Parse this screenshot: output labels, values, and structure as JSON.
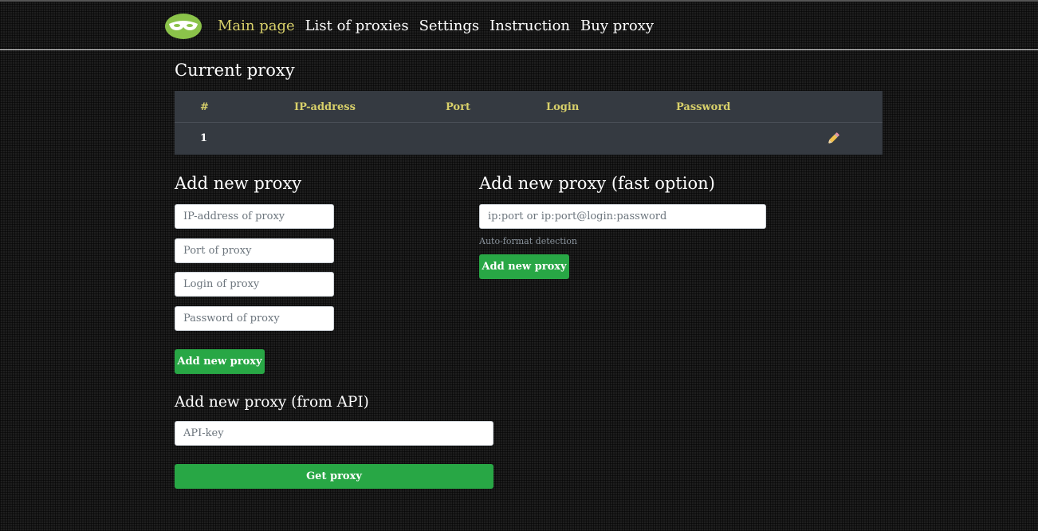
{
  "nav": {
    "items": [
      {
        "label": "Main page",
        "active": true
      },
      {
        "label": "List of proxies",
        "active": false
      },
      {
        "label": "Settings",
        "active": false
      },
      {
        "label": "Instruction",
        "active": false
      },
      {
        "label": "Buy proxy",
        "active": false
      }
    ],
    "active_color": "#d8d06a",
    "logo_icon": "green-mask-logo-icon"
  },
  "current_proxy": {
    "title": "Current proxy",
    "columns": [
      "#",
      "IP-address",
      "Port",
      "Login",
      "Password"
    ],
    "rows": [
      {
        "index": "1",
        "ip": "",
        "port": "",
        "login": "",
        "password": "",
        "action_icon": "pencil-icon"
      }
    ],
    "header_color": "#d8d06a",
    "background": "#353a41"
  },
  "add_proxy": {
    "title": "Add new proxy",
    "fields": [
      {
        "placeholder": "IP-address of proxy",
        "value": ""
      },
      {
        "placeholder": "Port of proxy",
        "value": ""
      },
      {
        "placeholder": "Login of proxy",
        "value": ""
      },
      {
        "placeholder": "Password of proxy",
        "value": ""
      }
    ],
    "button_label": "Add new proxy"
  },
  "add_proxy_fast": {
    "title": "Add new proxy (fast option)",
    "placeholder": "ip:port or ip:port@login:password",
    "value": "",
    "hint": "Auto-format detection",
    "button_label": "Add new proxy"
  },
  "add_proxy_api": {
    "title": "Add new proxy (from API)",
    "placeholder": "API-key",
    "value": "",
    "button_label": "Get proxy"
  },
  "colors": {
    "accent_green": "#28a745",
    "background": "#1e1e1e"
  }
}
